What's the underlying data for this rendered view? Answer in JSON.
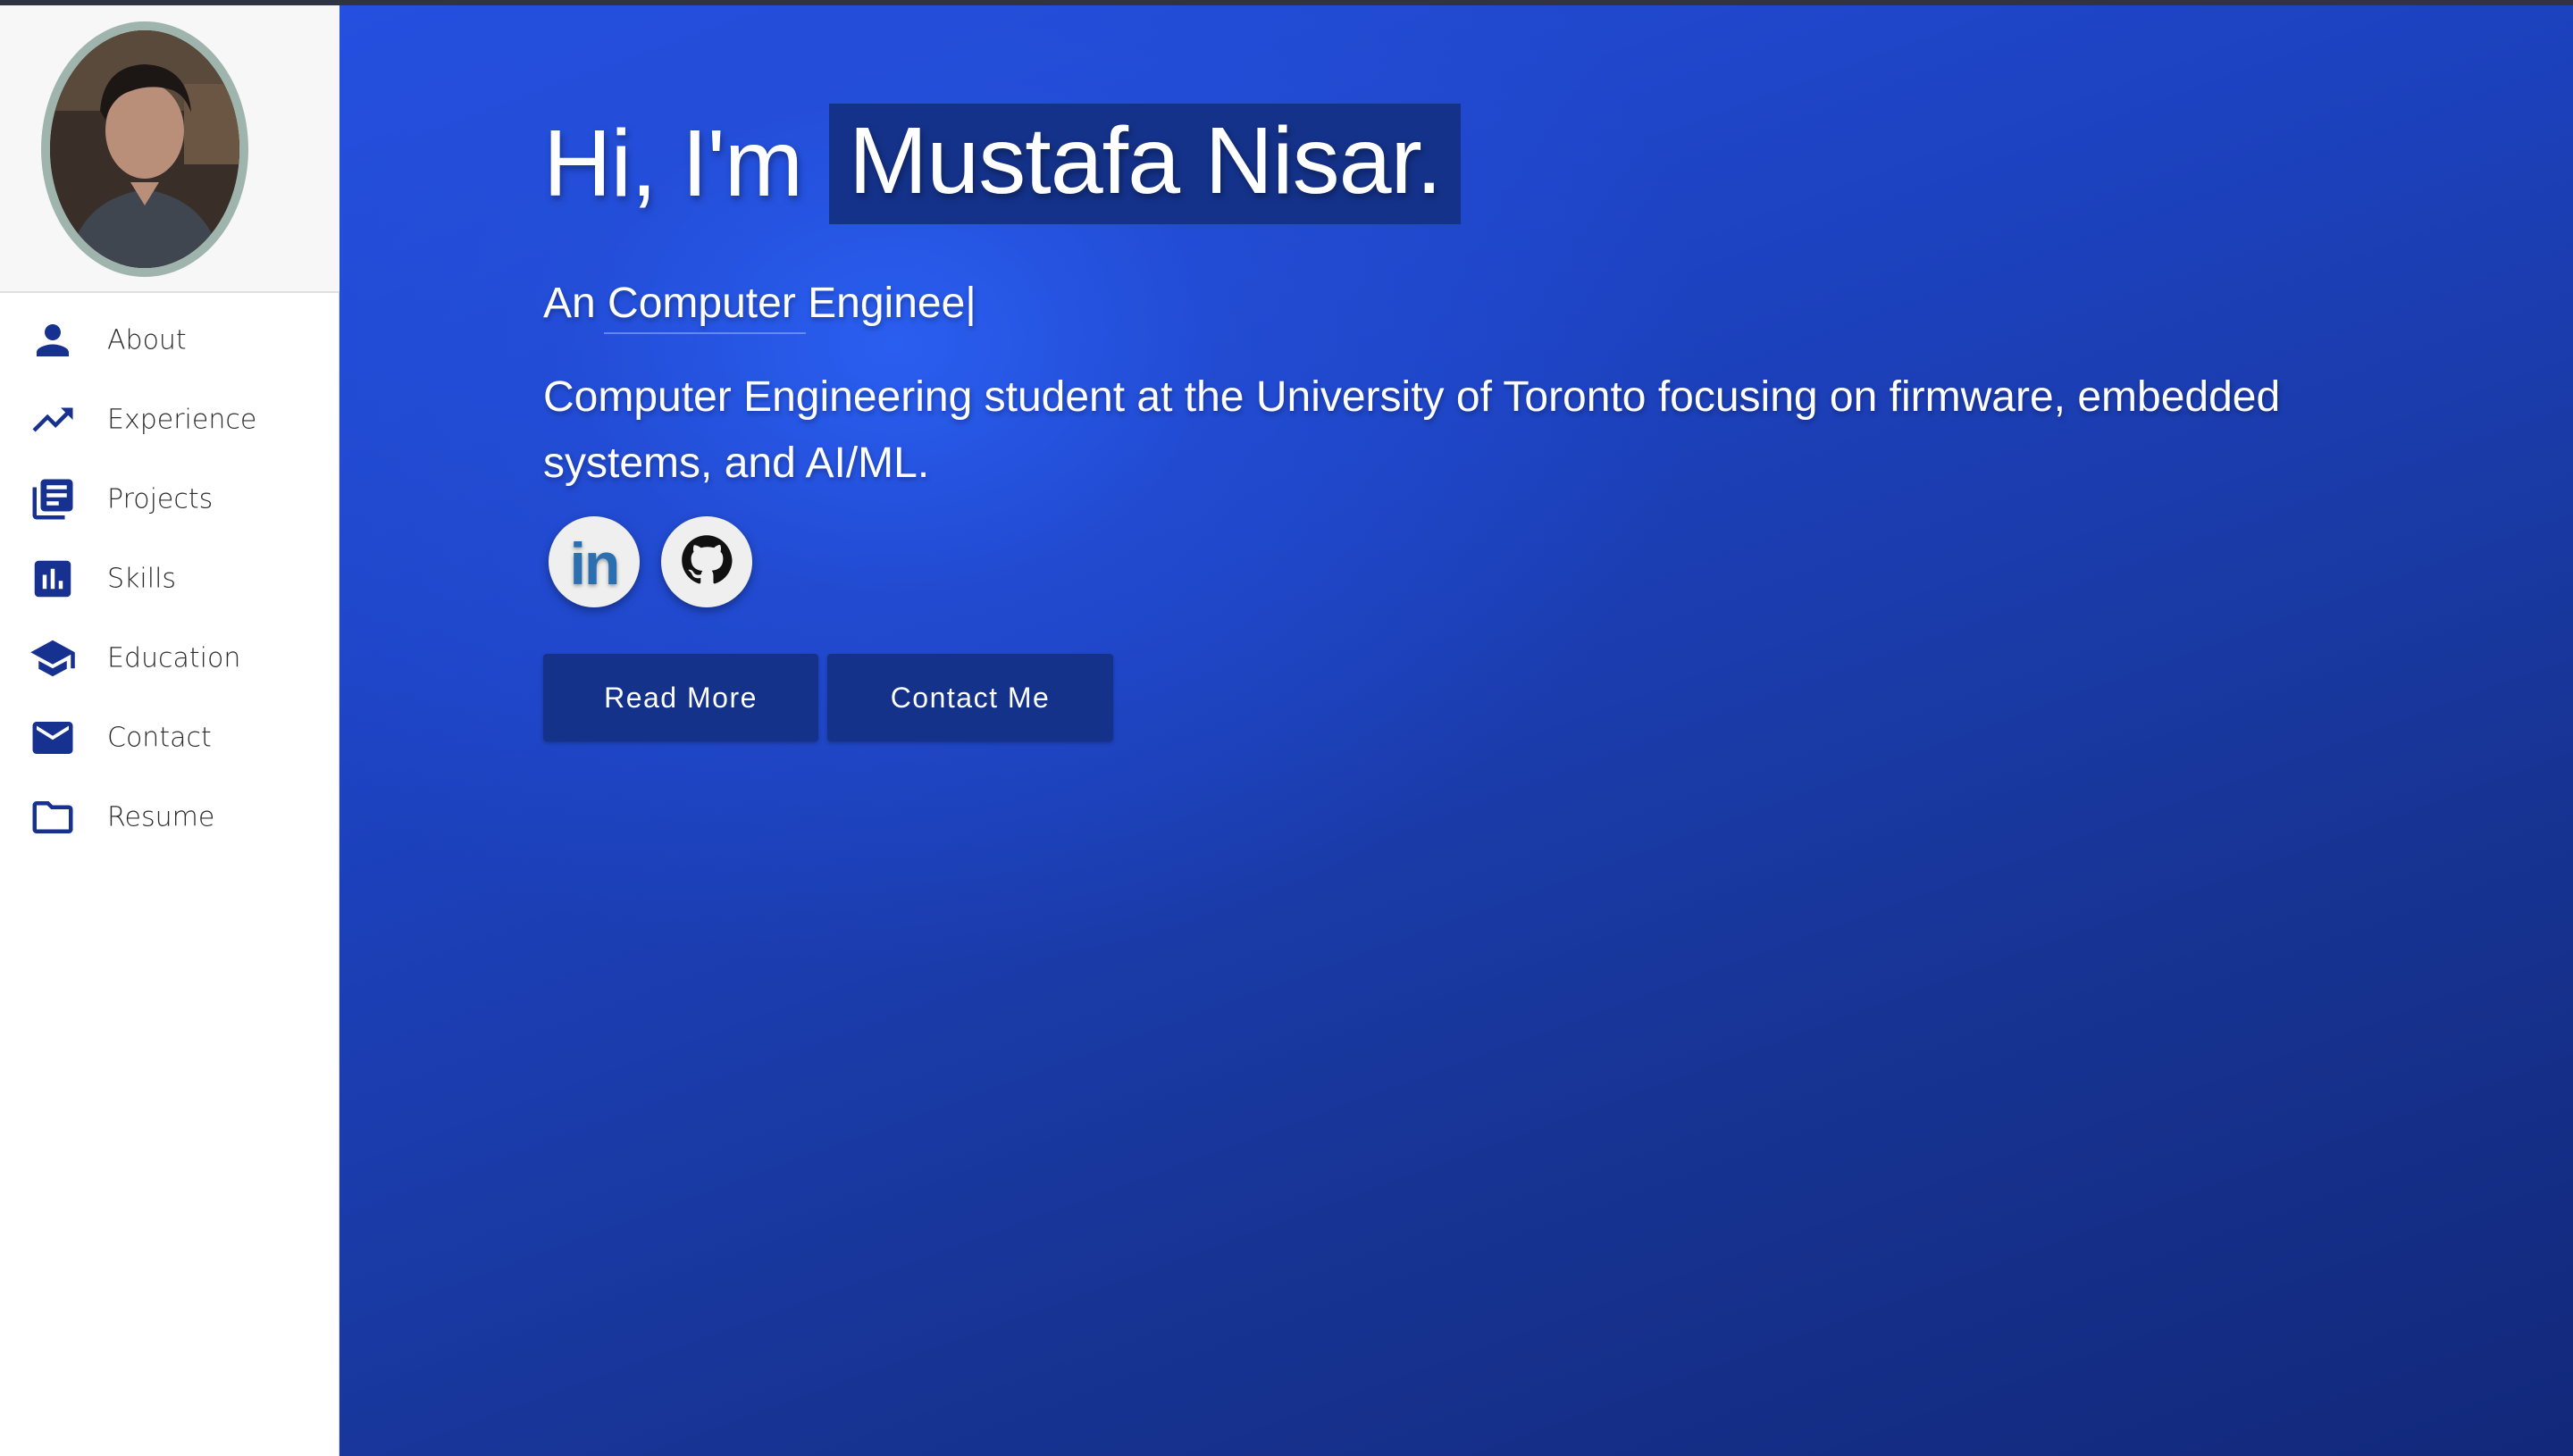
{
  "sidebar": {
    "items": [
      {
        "label": "About",
        "icon": "person-icon"
      },
      {
        "label": "Experience",
        "icon": "trending-up-icon"
      },
      {
        "label": "Projects",
        "icon": "article-icon"
      },
      {
        "label": "Skills",
        "icon": "bar-chart-icon"
      },
      {
        "label": "Education",
        "icon": "graduation-cap-icon"
      },
      {
        "label": "Contact",
        "icon": "mail-icon"
      },
      {
        "label": "Resume",
        "icon": "folder-icon"
      }
    ]
  },
  "hero": {
    "intro": "Hi, I'm",
    "name": "Mustafa Nisar.",
    "subtitle": "An Computer Enginee|",
    "description": "Computer Engineering student at the University of Toronto focusing on firmware, embedded systems, and AI/ML.",
    "social": {
      "linkedin_glyph": "in",
      "linkedin_icon": "linkedin-icon",
      "github_icon": "github-icon"
    },
    "buttons": {
      "read_more": "Read More",
      "contact_me": "Contact Me"
    }
  },
  "colors": {
    "accent": "#16318f",
    "hero_bg_light": "#2a5ef0",
    "hero_bg_dark": "#12287a",
    "highlight": "#14328a"
  }
}
